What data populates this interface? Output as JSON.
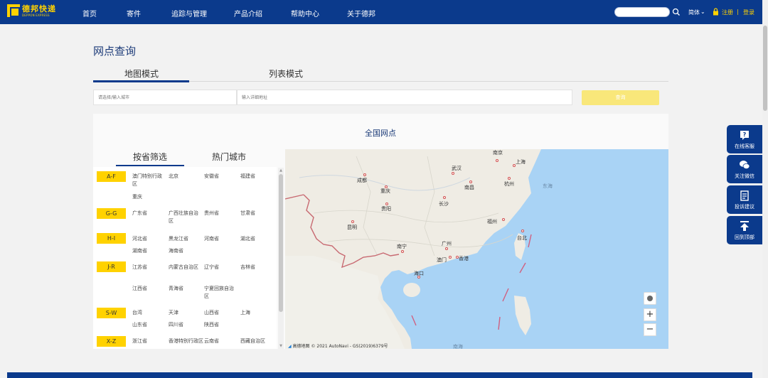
{
  "header": {
    "logo_cn": "德邦快递",
    "logo_en": "DEPPON EXPRESS",
    "nav": [
      "首页",
      "寄件",
      "追踪与管理",
      "产品介绍",
      "帮助中心",
      "关于德邦"
    ],
    "lang": "简体",
    "register": "注册",
    "separator": "|",
    "login": "登录"
  },
  "page": {
    "title": "网点查询",
    "tabs": [
      "地图模式",
      "列表模式"
    ],
    "active_tab": "地图模式"
  },
  "query": {
    "city_placeholder": "请选择/输入城市",
    "address_placeholder": "输入详细地址",
    "button": "查询"
  },
  "panel": {
    "title": "全国网点",
    "left_tabs": [
      "按省筛选",
      "热门城市"
    ]
  },
  "regions": [
    {
      "badge": "A-F",
      "provinces": [
        "澳门特别行政区",
        "北京",
        "安徽省",
        "福建省",
        "重庆"
      ]
    },
    {
      "badge": "G-G",
      "provinces": [
        "广东省",
        "广西壮族自治区",
        "贵州省",
        "甘肃省"
      ]
    },
    {
      "badge": "H-I",
      "provinces": [
        "河北省",
        "黑龙江省",
        "河南省",
        "湖北省",
        "湖南省",
        "海南省"
      ]
    },
    {
      "badge": "J-R",
      "provinces": [
        "江苏省",
        "内蒙古自治区",
        "辽宁省",
        "吉林省",
        "江西省",
        "青海省",
        "宁夏回族自治区"
      ]
    },
    {
      "badge": "S-W",
      "provinces": [
        "台湾",
        "天津",
        "山西省",
        "上海",
        "山东省",
        "四川省",
        "陕西省"
      ]
    },
    {
      "badge": "X-Z",
      "provinces": [
        "浙江省",
        "香港特别行政区",
        "云南省",
        "西藏自治区"
      ]
    }
  ],
  "map": {
    "cities": [
      "南京",
      "上海",
      "武汉",
      "成都",
      "杭州",
      "重庆",
      "南昌",
      "长沙",
      "贵阳",
      "福州",
      "昆明",
      "台北",
      "广州",
      "南宁",
      "澳门",
      "香港",
      "海口"
    ],
    "sea_labels": [
      "东海",
      "南海"
    ],
    "attribution_logo": "高德地图",
    "attribution": "© 2021 AutoNavi - GS(2019)6379号",
    "zoom_in": "+",
    "zoom_out": "−"
  },
  "float": [
    "在线客服",
    "关注微信",
    "投诉建议",
    "回到顶部"
  ]
}
